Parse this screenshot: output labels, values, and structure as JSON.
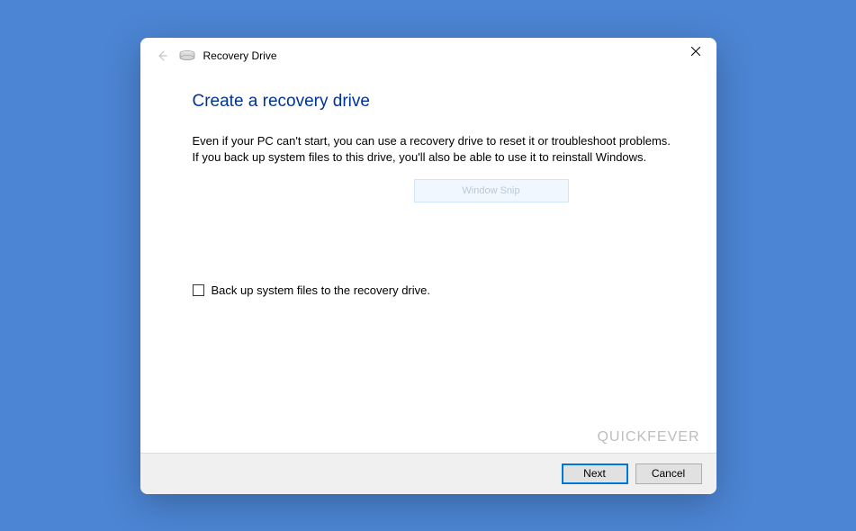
{
  "titlebar": {
    "title": "Recovery Drive"
  },
  "main": {
    "heading": "Create a recovery drive",
    "description": "Even if your PC can't start, you can use a recovery drive to reset it or troubleshoot problems. If you back up system files to this drive, you'll also be able to use it to reinstall Windows.",
    "snip_ghost": "Window Snip",
    "checkbox_label": "Back up system files to the recovery drive.",
    "checkbox_checked": false
  },
  "footer": {
    "next_label": "Next",
    "cancel_label": "Cancel"
  },
  "watermark": "QUICKFEVER"
}
